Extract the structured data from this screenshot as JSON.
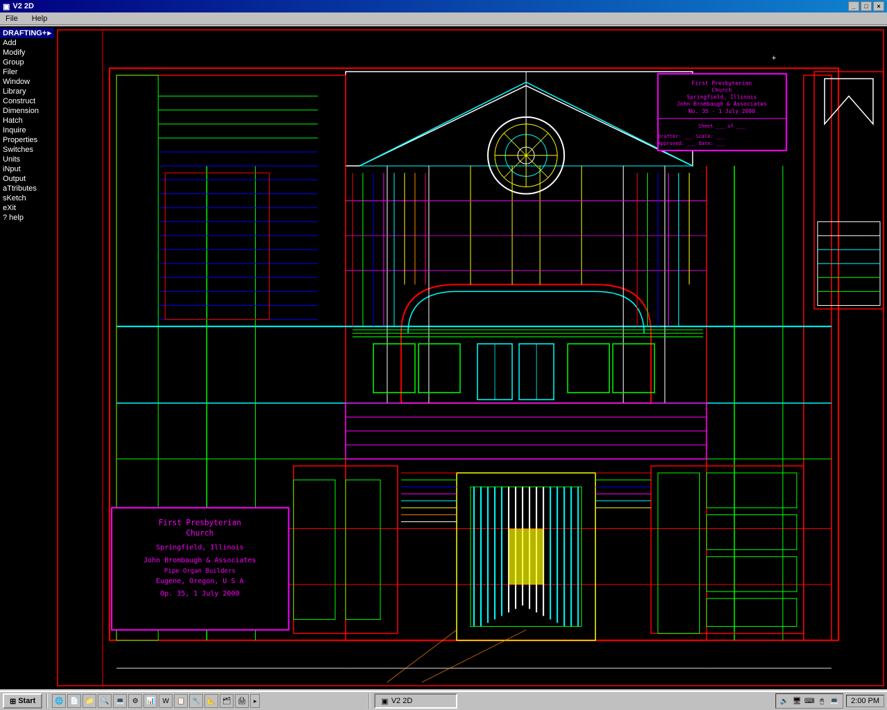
{
  "window": {
    "title": "V2 2D",
    "title_icon": "▣"
  },
  "menu": {
    "items": [
      "File",
      "Help"
    ]
  },
  "left_panel": {
    "header": "DRAFTING+",
    "items": [
      "Add",
      "Modify",
      "Group",
      "Filer",
      "Window",
      "Library",
      "Construct",
      "Dimension",
      "Hatch",
      "Inquire",
      "Properties",
      "Switches",
      "Units",
      "iNput",
      "Output",
      "aTtributes",
      "sKetch",
      "eXit",
      "? help"
    ]
  },
  "title_block_main": {
    "line1": "First Presbyterian",
    "line2": "Church",
    "line3": "Springfield, Illinois",
    "line4": "John Brombaugh & Associates",
    "line5": "Pipe Organ Builders",
    "line6": "Eugene, Oregon, U S A",
    "line7": "Op. 35, 1 July 2000"
  },
  "title_block_top_right": {
    "line1": "First Presbyterian",
    "line2": "Church",
    "line3": "Springfield, Illinois",
    "line4": "John Brombaugh & Associates",
    "line5": "No. 35 - 1 July 2000"
  },
  "crosshair": "+",
  "taskbar": {
    "start_label": "Start",
    "active_window_icon": "▣",
    "active_window_label": "V2 2D",
    "time": "2:00 PM"
  },
  "taskbar_icons": [
    "🌐",
    "📄",
    "📁",
    "🔍",
    "💻",
    "⚙",
    "📊",
    "W",
    "📋",
    "🔧",
    "📐",
    "🗂",
    "🖨"
  ],
  "system_tray_icons": [
    "🔊",
    "🖥",
    "⌨",
    "🖱",
    "💻",
    "🕐"
  ]
}
